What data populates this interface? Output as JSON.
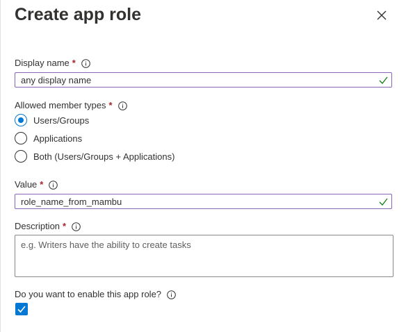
{
  "panel": {
    "title": "Create app role"
  },
  "display_name": {
    "label": "Display name",
    "required_mark": "*",
    "value": "any display name"
  },
  "member_types": {
    "label": "Allowed member types",
    "required_mark": "*",
    "options": [
      {
        "label": "Users/Groups",
        "selected": true
      },
      {
        "label": "Applications",
        "selected": false
      },
      {
        "label": "Both (Users/Groups + Applications)",
        "selected": false
      }
    ]
  },
  "value_field": {
    "label": "Value",
    "required_mark": "*",
    "value": "role_name_from_mambu"
  },
  "description": {
    "label": "Description",
    "required_mark": "*",
    "placeholder": "e.g. Writers have the ability to create tasks"
  },
  "enable_role": {
    "label": "Do you want to enable this app role?",
    "checked": true
  },
  "colors": {
    "accent": "#0078d4",
    "valid_check": "#107c10",
    "focus_border": "#8764b8",
    "required": "#a4262c"
  }
}
